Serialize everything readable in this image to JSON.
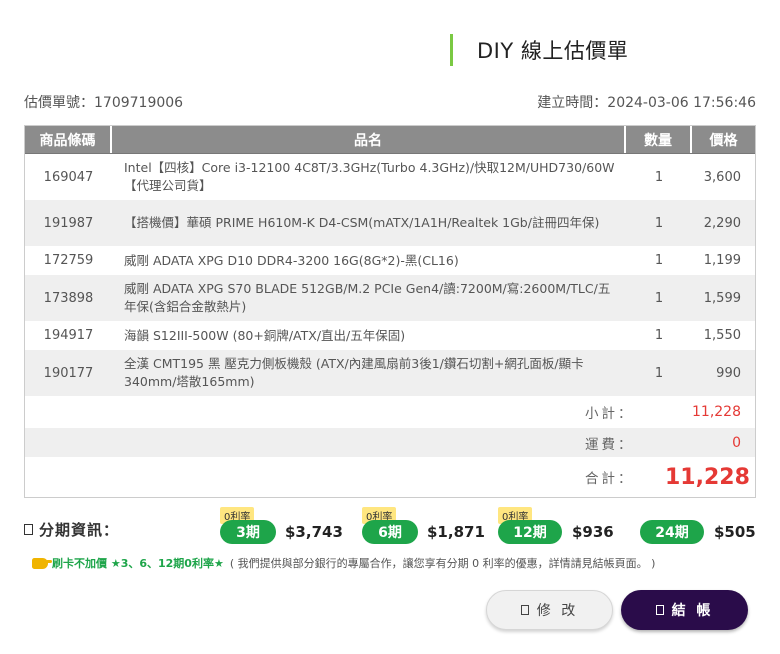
{
  "header": {
    "title": "DIY 線上估價單"
  },
  "meta": {
    "quote_no_label": "估價單號：1709719006",
    "created_label": "建立時間：2024-03-06 17:56:46"
  },
  "table": {
    "headers": [
      "商品條碼",
      "品名",
      "數量",
      "價格"
    ],
    "rows": [
      {
        "id": "169047",
        "name": "Intel【四核】Core i3-12100 4C8T/3.3GHz(Turbo 4.3GHz)/快取12M/UHD730/60W【代理公司貨】",
        "qty": "1",
        "price": "3,600"
      },
      {
        "id": "191987",
        "name": "【搭機價】華碩 PRIME H610M-K D4-CSM(mATX/1A1H/Realtek 1Gb/註冊四年保)",
        "qty": "1",
        "price": "2,290"
      },
      {
        "id": "172759",
        "name": "威剛 ADATA XPG D10 DDR4-3200 16G(8G*2)-黑(CL16)",
        "qty": "1",
        "price": "1,199"
      },
      {
        "id": "173898",
        "name": "威剛 ADATA XPG S70 BLADE 512GB/M.2 PCIe Gen4/讀:7200M/寫:2600M/TLC/五年保(含鋁合金散熱片)",
        "qty": "1",
        "price": "1,599"
      },
      {
        "id": "194917",
        "name": "海韻 S12III-500W (80+銅牌/ATX/直出/五年保固)",
        "qty": "1",
        "price": "1,550"
      },
      {
        "id": "190177",
        "name": "全漢 CMT195 黑 壓克力側板機殼 (ATX/內建風扇前3後1/鑽石切割+網孔面板/顯卡340mm/塔散165mm)",
        "qty": "1",
        "price": "990"
      }
    ]
  },
  "summary": {
    "subtotal_label": "小計：",
    "subtotal": "11,228",
    "shipping_label": "運費：",
    "shipping": "0",
    "total_label": "合計：",
    "total": "11,228"
  },
  "installments": {
    "label": "分期資訊：",
    "plans": [
      {
        "badge": "0利率",
        "term": "3期",
        "amount": "$3,743"
      },
      {
        "badge": "0利率",
        "term": "6期",
        "amount": "$1,871"
      },
      {
        "badge": "0利率",
        "term": "12期",
        "amount": "$936"
      },
      {
        "badge": "",
        "term": "24期",
        "amount": "$505"
      }
    ]
  },
  "promo": {
    "highlight": "刷卡不加價 ★3、6、12期0利率★",
    "text": "( 我們提供與部分銀行的專屬合作，讓您享有分期 0 利率的優惠，詳情請見結帳頁面。 )"
  },
  "buttons": {
    "edit": "修 改",
    "checkout": "結 帳"
  },
  "colors": {
    "accent_green": "#1ea54a",
    "price_red": "#e53935",
    "checkout_bg": "#2a0c4a",
    "header_gray": "#8c8c8c"
  }
}
